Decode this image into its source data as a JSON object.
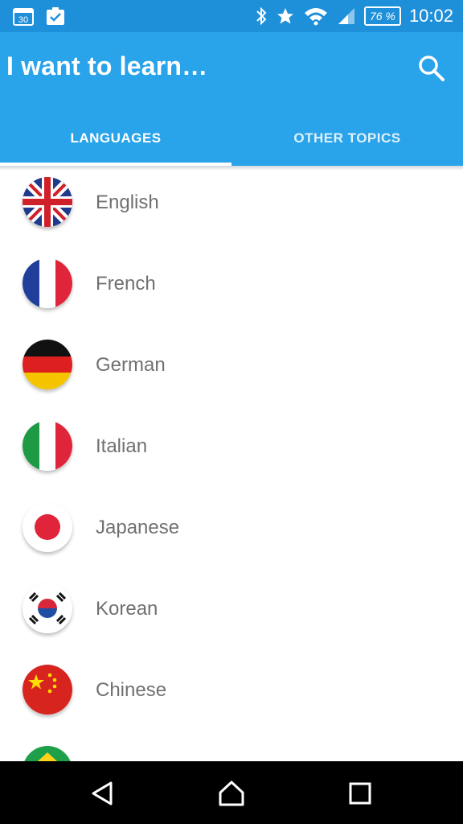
{
  "status": {
    "battery": "76 %",
    "time": "10:02",
    "calendar_day": "30"
  },
  "header": {
    "title": "I want to learn…",
    "search_icon": "search-icon"
  },
  "tabs": [
    {
      "label": "LANGUAGES",
      "active": true
    },
    {
      "label": "OTHER TOPICS",
      "active": false
    }
  ],
  "languages": [
    {
      "label": "English",
      "flag": "uk-flag-icon"
    },
    {
      "label": "French",
      "flag": "france-flag-icon"
    },
    {
      "label": "German",
      "flag": "germany-flag-icon"
    },
    {
      "label": "Italian",
      "flag": "italy-flag-icon"
    },
    {
      "label": "Japanese",
      "flag": "japan-flag-icon"
    },
    {
      "label": "Korean",
      "flag": "korea-flag-icon"
    },
    {
      "label": "Chinese",
      "flag": "china-flag-icon"
    }
  ],
  "colors": {
    "status_bar": "#1e8fd9",
    "app_bar": "#29a3ea",
    "list_text": "#707070"
  }
}
